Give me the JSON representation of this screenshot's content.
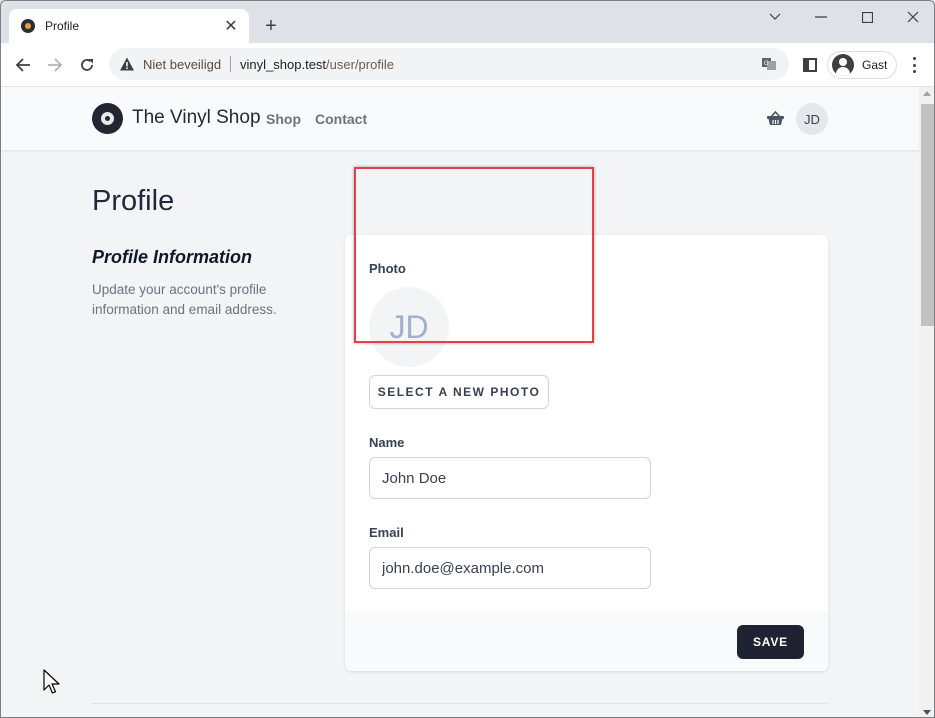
{
  "browser": {
    "tab_title": "Profile",
    "tab_close": "✕",
    "new_tab": "+",
    "window_controls": {
      "tab_search": "⌄",
      "minimize": "—",
      "maximize": "☐",
      "close": "✕"
    },
    "nav": {
      "back": "←",
      "forward": "→",
      "reload": "↻"
    },
    "security_label": "Niet beveiligd",
    "url_host": "vinyl_shop.test",
    "url_path": "/user/profile",
    "profile_name": "Gast"
  },
  "site": {
    "brand": "The Vinyl Shop",
    "nav_links": [
      {
        "label": "Shop"
      },
      {
        "label": "Contact"
      }
    ],
    "user_initials": "JD"
  },
  "page": {
    "title": "Profile",
    "section": {
      "title": "Profile Information",
      "description": "Update your account's profile information and email address."
    },
    "form": {
      "photo_label": "Photo",
      "photo_initials": "JD",
      "select_photo_label": "SELECT A NEW PHOTO",
      "name_label": "Name",
      "name_value": "John Doe",
      "email_label": "Email",
      "email_value": "john.doe@example.com",
      "save_label": "SAVE"
    }
  },
  "annotation": {
    "highlight_color": "#e53e46"
  }
}
